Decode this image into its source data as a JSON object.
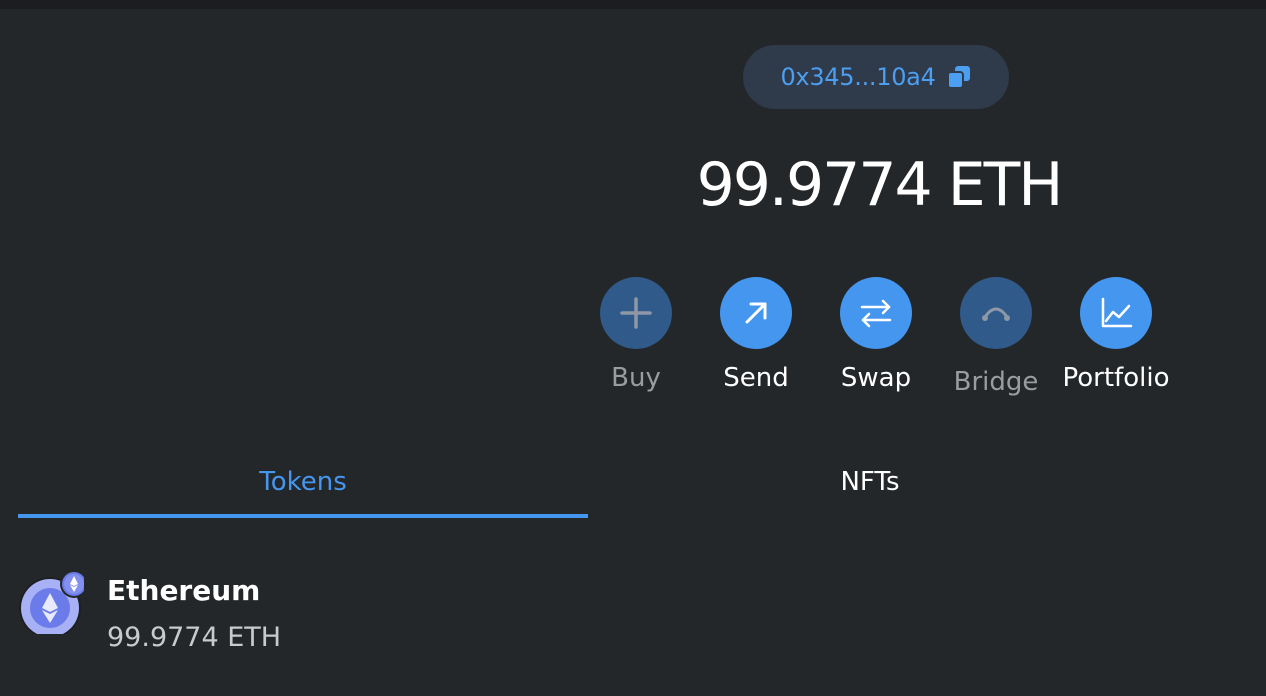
{
  "account": {
    "address_short": "0x345...10a4",
    "balance": "99.9774 ETH"
  },
  "actions": [
    {
      "label": "Buy",
      "icon": "plus-icon",
      "enabled": false
    },
    {
      "label": "Send",
      "icon": "arrow-up-right-icon",
      "enabled": true
    },
    {
      "label": "Swap",
      "icon": "swap-arrows-icon",
      "enabled": true
    },
    {
      "label": "Bridge",
      "icon": "bridge-icon",
      "enabled": false
    },
    {
      "label": "Portfolio",
      "icon": "chart-icon",
      "enabled": true
    }
  ],
  "tabs": [
    {
      "label": "Tokens",
      "active": true
    },
    {
      "label": "NFTs",
      "active": false
    }
  ],
  "tokens": [
    {
      "name": "Ethereum",
      "balance": "99.9774 ETH",
      "icon": "ethereum-icon",
      "network_badge": "ethereum-network-badge-icon"
    }
  ],
  "colors": {
    "background": "#24272a",
    "accent": "#4596ee",
    "accent_disabled": "#2f5a8a",
    "address_pill_bg": "#2f3a4a",
    "address_text": "#4c9ef0",
    "muted_text": "#9a9ca0"
  }
}
